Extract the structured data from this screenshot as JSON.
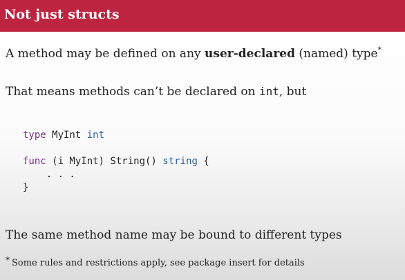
{
  "slide": {
    "title": "Not just structs",
    "para1": {
      "before": "A method may be defined on any ",
      "bold": "user-declared",
      "after": " (named) type",
      "marker": "*"
    },
    "para2": {
      "before": "That means methods can’t be declared on ",
      "code": "int",
      "after": ", but"
    },
    "code": {
      "line1": {
        "kw": "type",
        "name": " MyInt ",
        "type": "int"
      },
      "line2": {
        "kw": "func",
        "rest": " (i MyInt) String() ",
        "type": "string",
        "brace": " {"
      },
      "line3": "    . . .",
      "line4": "}"
    },
    "para3": "The same method name may be bound to different types",
    "footnote": {
      "marker": "*",
      "text": "Some rules and restrictions apply, see package insert for details"
    }
  },
  "colors": {
    "title_bar": "#bc2440",
    "keyword": "#7a2c8a",
    "type": "#2a5f9e"
  }
}
